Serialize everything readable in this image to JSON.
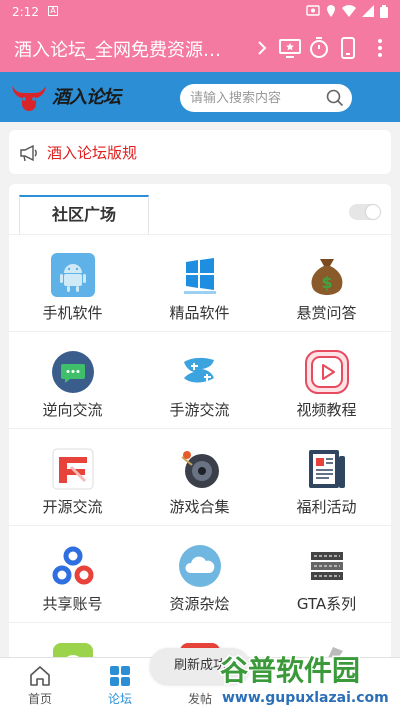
{
  "status_bar": {
    "time": "2:12",
    "a_badge": "A"
  },
  "app_bar": {
    "title": "酒入论坛_全网免费资源基..."
  },
  "forum_header": {
    "logo_text": "酒入论坛",
    "search_placeholder": "请输入搜索内容"
  },
  "notice": {
    "text": "酒入论坛版规"
  },
  "community": {
    "tab_label": "社区广场",
    "rows": [
      [
        {
          "label": "手机软件",
          "icon": "android-icon"
        },
        {
          "label": "精品软件",
          "icon": "windows-icon"
        },
        {
          "label": "悬赏问答",
          "icon": "money-bag-icon"
        }
      ],
      [
        {
          "label": "逆向交流",
          "icon": "chat-bubble-icon"
        },
        {
          "label": "手游交流",
          "icon": "mobile-game-icon"
        },
        {
          "label": "视频教程",
          "icon": "video-play-icon"
        }
      ],
      [
        {
          "label": "开源交流",
          "icon": "open-source-icon"
        },
        {
          "label": "游戏合集",
          "icon": "game-disc-icon"
        },
        {
          "label": "福利活动",
          "icon": "newspaper-icon"
        }
      ],
      [
        {
          "label": "共享账号",
          "icon": "share-network-icon"
        },
        {
          "label": "资源杂烩",
          "icon": "cloud-icon"
        },
        {
          "label": "GTA系列",
          "icon": "gta-logo-icon"
        }
      ]
    ]
  },
  "bottom_nav": {
    "items": [
      {
        "label": "首页",
        "icon": "home-icon",
        "active": false
      },
      {
        "label": "论坛",
        "icon": "grid-icon",
        "active": true
      },
      {
        "label": "发帖",
        "icon": "post-icon",
        "active": false
      }
    ]
  },
  "toast": {
    "text": "刷新成功"
  },
  "watermark": {
    "text_main": "谷普软件园",
    "text_url": "www.gupuxlazai.com"
  },
  "colors": {
    "accent": "#f47aa2",
    "header_blue": "#2c8fd6",
    "notice_red": "#e02020"
  }
}
